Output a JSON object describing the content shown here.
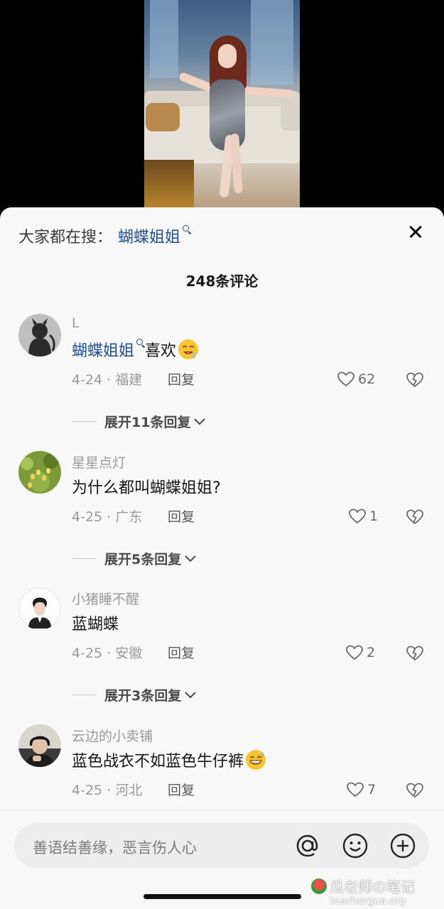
{
  "search": {
    "prefix": "大家都在搜：",
    "term": "蝴蝶姐姐"
  },
  "comment_count": "248条评论",
  "comments": [
    {
      "username": "L",
      "link_text": "蝴蝶姐姐",
      "text": "喜欢",
      "emoji": "drooling-face-emoji",
      "date_region": "4-24 · 福建",
      "reply_label": "回复",
      "likes": "62",
      "expand": "展开11条回复"
    },
    {
      "username": "星星点灯",
      "text": "为什么都叫蝴蝶姐姐?",
      "date_region": "4-25 · 广东",
      "reply_label": "回复",
      "likes": "1",
      "expand": "展开5条回复"
    },
    {
      "username": "小猪睡不醒",
      "text": "蓝蝴蝶",
      "date_region": "4-25 · 安徽",
      "reply_label": "回复",
      "likes": "2",
      "expand": "展开3条回复"
    },
    {
      "username": "云边的小卖铺",
      "text": "蓝色战衣不如蓝色牛仔裤",
      "emoji": "grinning-sweat-emoji",
      "date_region": "4-25 · 河北",
      "reply_label": "回复",
      "likes": "7"
    }
  ],
  "input": {
    "placeholder": "善语结善缘，恶言伤人心"
  },
  "watermark": {
    "title": "瓜老师の笔记",
    "url": "teachergua.org"
  },
  "colors": {
    "link": "#1f4d8f",
    "sheet_bg": "#f8f8f8",
    "meta_text": "#9a9a9a"
  }
}
